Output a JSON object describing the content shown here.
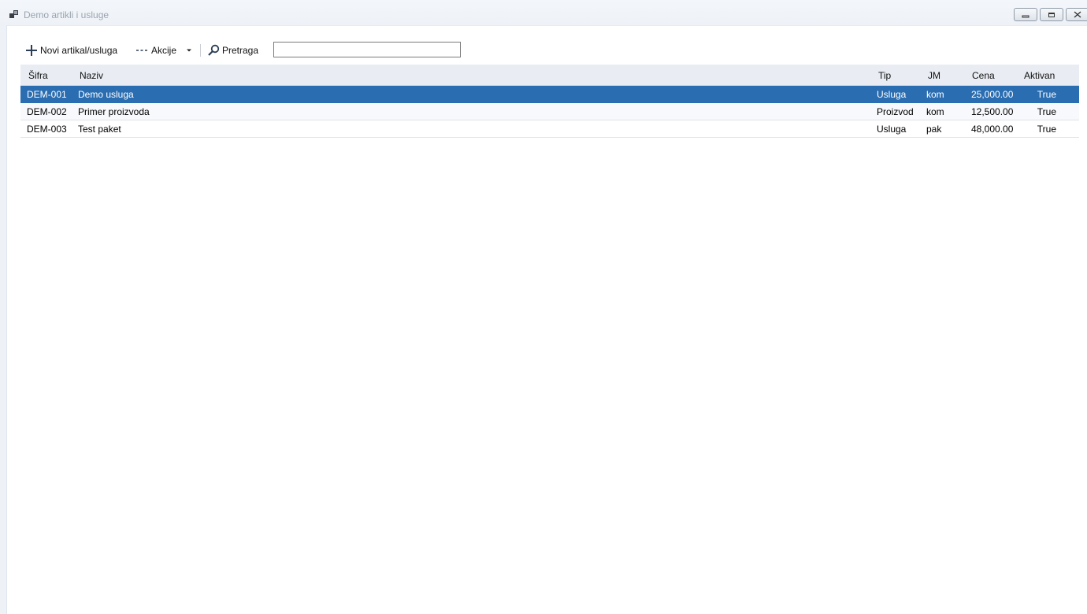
{
  "window": {
    "title": "Demo artikli i usluge",
    "controls": {
      "minimize_icon": "minimize-icon",
      "restore_icon": "restore-icon",
      "close_icon": "close-icon"
    }
  },
  "toolbar": {
    "new_label": "Novi artikal/usluga",
    "actions_label": "Akcije",
    "search_label": "Pretraga",
    "search_value": "",
    "search_placeholder": ""
  },
  "grid": {
    "columns": [
      "Šifra",
      "Naziv",
      "Tip",
      "JM",
      "Cena",
      "Aktivan"
    ],
    "rows": [
      [
        "DEM-001",
        "Demo usluga",
        "Usluga",
        "kom",
        "25,000.00",
        "True"
      ],
      [
        "DEM-002",
        "Primer proizvoda",
        "Proizvod",
        "kom",
        "12,500.00",
        "True"
      ],
      [
        "DEM-003",
        "Test paket",
        "Usluga",
        "pak",
        "48,000.00",
        "True"
      ]
    ],
    "selected_row": 0
  },
  "colors": {
    "selection": "#2a6db1",
    "header_bg": "#e9edf3",
    "title_text": "#9aa4b0"
  }
}
